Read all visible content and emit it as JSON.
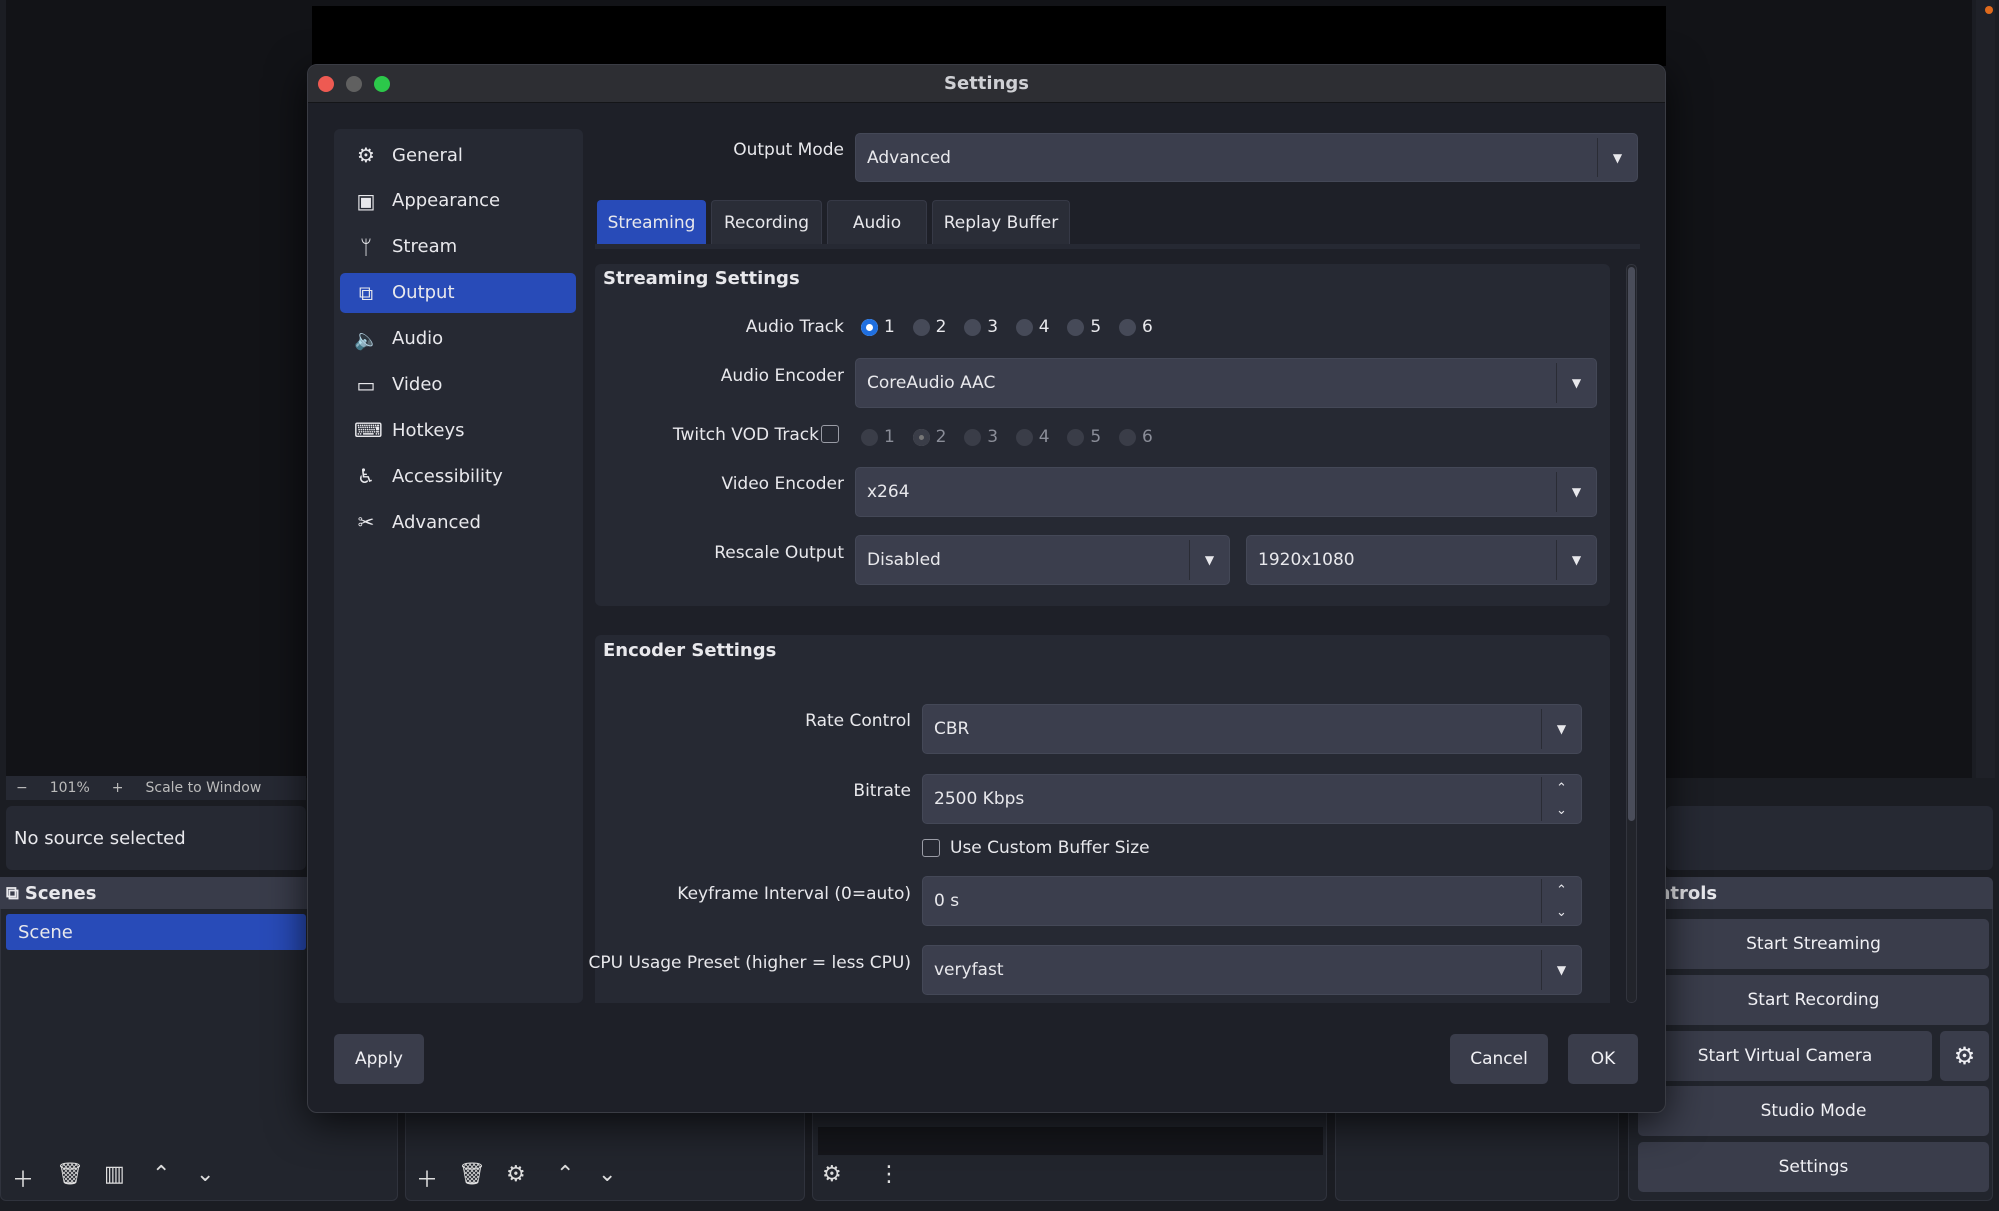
{
  "colors": {
    "accent": "#284bb8",
    "background": "#1b1d23",
    "panel": "#262933",
    "field": "#3b3e4d",
    "close": "#ee5a52",
    "minimize": "#606060",
    "zoom": "#2cc84a"
  },
  "main_window": {
    "preview_toolbar": {
      "zoom_out": "−",
      "zoom_level": "101%",
      "zoom_in": "+",
      "scale_mode": "Scale to Window"
    },
    "source_info": "No source selected",
    "scenes": {
      "title": "Scenes",
      "items": [
        "Scene"
      ]
    },
    "controls": {
      "title": "Controls",
      "title_visible": "ontrols",
      "start_streaming": "Start Streaming",
      "start_recording": "Start Recording",
      "start_virtual_camera": "Start Virtual Camera",
      "studio_mode": "Studio Mode",
      "settings": "Settings"
    }
  },
  "dialog": {
    "title": "Settings",
    "sidebar": [
      {
        "label": "General",
        "icon": "gear-icon"
      },
      {
        "label": "Appearance",
        "icon": "appearance-icon"
      },
      {
        "label": "Stream",
        "icon": "antenna-icon"
      },
      {
        "label": "Output",
        "icon": "output-icon",
        "selected": true
      },
      {
        "label": "Audio",
        "icon": "speaker-icon"
      },
      {
        "label": "Video",
        "icon": "monitor-icon"
      },
      {
        "label": "Hotkeys",
        "icon": "keyboard-icon"
      },
      {
        "label": "Accessibility",
        "icon": "accessibility-icon"
      },
      {
        "label": "Advanced",
        "icon": "tools-icon"
      }
    ],
    "output_mode": {
      "label": "Output Mode",
      "value": "Advanced"
    },
    "tabs": [
      {
        "label": "Streaming",
        "active": true
      },
      {
        "label": "Recording"
      },
      {
        "label": "Audio"
      },
      {
        "label": "Replay Buffer"
      }
    ],
    "streaming_settings": {
      "title": "Streaming Settings",
      "audio_track": {
        "label": "Audio Track",
        "options": [
          "1",
          "2",
          "3",
          "4",
          "5",
          "6"
        ],
        "selected": "1"
      },
      "audio_encoder": {
        "label": "Audio Encoder",
        "value": "CoreAudio AAC"
      },
      "twitch_vod_track": {
        "label": "Twitch VOD Track",
        "checked": false,
        "options": [
          "1",
          "2",
          "3",
          "4",
          "5",
          "6"
        ],
        "selected": "2"
      },
      "video_encoder": {
        "label": "Video Encoder",
        "value": "x264"
      },
      "rescale_output": {
        "label": "Rescale Output",
        "value": "Disabled",
        "resolution": "1920x1080"
      }
    },
    "encoder_settings": {
      "title": "Encoder Settings",
      "rate_control": {
        "label": "Rate Control",
        "value": "CBR"
      },
      "bitrate": {
        "label": "Bitrate",
        "value": "2500 Kbps"
      },
      "custom_buffer": {
        "label": "Use Custom Buffer Size",
        "checked": false
      },
      "keyframe_interval": {
        "label": "Keyframe Interval (0=auto)",
        "value": "0 s"
      },
      "cpu_preset": {
        "label": "CPU Usage Preset (higher = less CPU)",
        "value": "veryfast"
      }
    },
    "buttons": {
      "apply": "Apply",
      "cancel": "Cancel",
      "ok": "OK"
    }
  }
}
